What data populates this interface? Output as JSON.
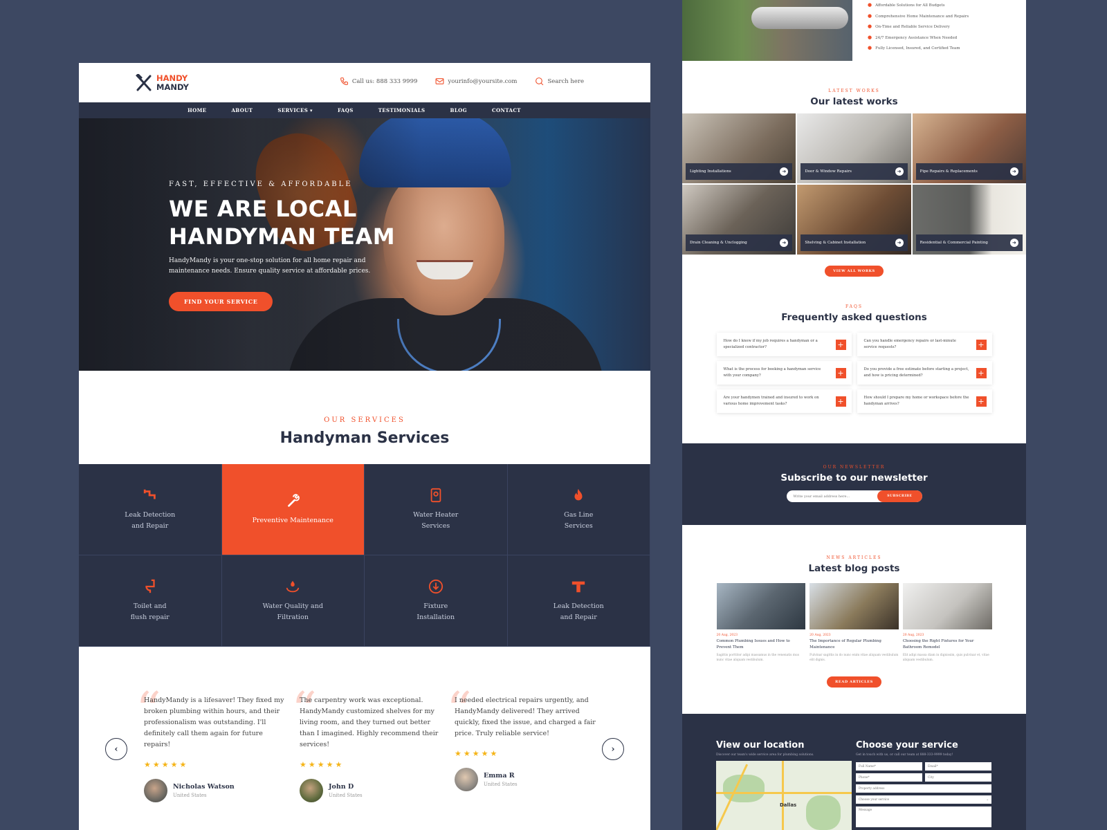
{
  "left": {
    "logo": {
      "line1": "HANDY",
      "line2": "MANDY"
    },
    "contacts": {
      "phone": "Call us: 888 333 9999",
      "email": "yourinfo@yoursite.com",
      "search": "Search here"
    },
    "nav": [
      "HOME",
      "ABOUT",
      "SERVICES ▾",
      "FAQS",
      "TESTIMONIALS",
      "BLOG",
      "CONTACT"
    ],
    "hero": {
      "kicker": "FAST, EFFECTIVE & AFFORDABLE",
      "title_line1": "We are local",
      "title_line2": "handyman team",
      "description": "HandyMandy is your one-stop solution for all home repair and maintenance needs. Ensure quality service at affordable prices.",
      "cta": "FIND YOUR SERVICE"
    },
    "services": {
      "kicker": "OUR SERVICES",
      "title": "Handyman Services",
      "items": [
        {
          "line1": "Leak Detection",
          "line2": "and Repair",
          "icon": "pipe-icon"
        },
        {
          "line1": "Preventive Maintenance",
          "line2": "",
          "icon": "wrench-icon"
        },
        {
          "line1": "Water Heater",
          "line2": "Services",
          "icon": "water-heater-icon"
        },
        {
          "line1": "Gas Line",
          "line2": "Services",
          "icon": "flame-icon"
        },
        {
          "line1": "Toilet and",
          "line2": "flush repair",
          "icon": "toilet-icon"
        },
        {
          "line1": "Water Quality and",
          "line2": "Filtration",
          "icon": "water-drop-icon"
        },
        {
          "line1": "Fixture",
          "line2": "Installation",
          "icon": "download-circle-icon"
        },
        {
          "line1": "Leak Detection",
          "line2": "and Repair",
          "icon": "t-pipe-icon"
        }
      ]
    },
    "testimonials": [
      {
        "text": "HandyMandy is a lifesaver! They fixed my broken plumbing within hours, and their professionalism was outstanding. I'll definitely call them again for future repairs!",
        "stars": "★★★★★",
        "name": "Nicholas Watson",
        "location": "United States"
      },
      {
        "text": "The carpentry work was exceptional. HandyMandy customized shelves for my living room, and they turned out better than I imagined. Highly recommend their services!",
        "stars": "★★★★★",
        "name": "John D",
        "location": "United States"
      },
      {
        "text": "I needed electrical repairs urgently, and HandyMandy delivered! They arrived quickly, fixed the issue, and charged a fair price. Truly reliable service!",
        "stars": "★★★★★",
        "name": "Emma R",
        "location": "United States"
      }
    ],
    "arrows": {
      "prev": "‹",
      "next": "›"
    }
  },
  "right": {
    "benefits": [
      "Affordable Solutions for All Budgets",
      "Comprehensive Home Maintenance and Repairs",
      "On-Time and Reliable Service Delivery",
      "24/7 Emergency Assistance When Needed",
      "Fully Licensed, Insured, and Certified Team"
    ],
    "works": {
      "kicker": "LATEST WORKS",
      "title": "Our latest works",
      "items": [
        "Lighting Installations",
        "Door & Window Repairs",
        "Pipe Repairs & Replacements",
        "Drain Cleaning & Unclogging",
        "Shelving & Cabinet Installation",
        "Residential & Commercial Painting"
      ],
      "cta": "VIEW ALL WORKS"
    },
    "faq": {
      "kicker": "FAQS",
      "title": "Frequently asked questions",
      "items": [
        "How do I know if my job requires a handyman or a specialized contractor?",
        "Can you handle emergency repairs or last-minute service requests?",
        "What is the process for booking a handyman service with your company?",
        "Do you provide a free estimate before starting a project, and how is pricing determined?",
        "Are your handymen trained and insured to work on various home improvement tasks?",
        "How should I prepare my home or workspace before the handyman arrives?"
      ]
    },
    "newsletter": {
      "kicker": "OUR NEWSLETTER",
      "title": "Subscribe to our newsletter",
      "placeholder": "Write your email address here...",
      "button": "SUBSCRIBE"
    },
    "blog": {
      "kicker": "NEWS ARTICLES",
      "title": "Latest blog posts",
      "posts": [
        {
          "date": "20 Aug, 2023",
          "title": "Common Plumbing Issues and How to Prevent Them",
          "excerpt": "Sagittis porttitor adipi massamus in the venenatis mus nunc vitae aliquam vestibulum."
        },
        {
          "date": "20 Aug, 2023",
          "title": "The Importance of Regular Plumbing Maintenance",
          "excerpt": "Fulvinar sagittis in do nunc enim vitae aliquam vestibulum elit dignis."
        },
        {
          "date": "20 Aug, 2023",
          "title": "Choosing the Right Fixtures for Your Bathroom Remodel",
          "excerpt": "Elit adipi massa diam in dignissim, quis pulvinar et, vitae aliquam vestibulum."
        }
      ],
      "cta": "READ ARTICLES"
    },
    "footer": {
      "location_title": "View our location",
      "location_sub": "Discover our team's wide service area for plumbing solutions.",
      "map_label": "Dallas",
      "service_title": "Choose your service",
      "service_sub": "Get in touch with us, or call our team at 888-333-9999 today!",
      "fields": [
        "Full Name*",
        "Email*",
        "Phone*",
        "City",
        "Property address",
        "Choose your service",
        "Message"
      ]
    }
  },
  "colors": {
    "accent": "#f0502b",
    "navy": "#2b3246",
    "background": "#3d4862"
  }
}
